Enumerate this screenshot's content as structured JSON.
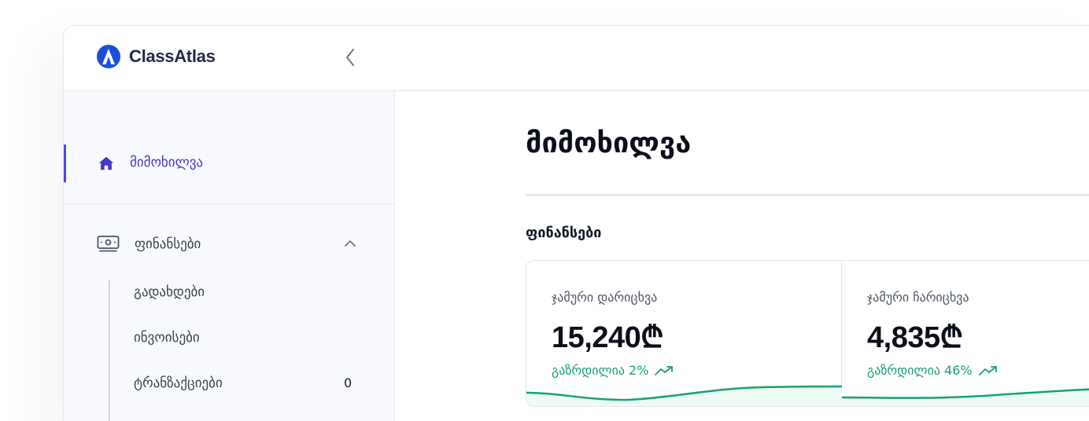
{
  "app": {
    "name": "ClassAtlas"
  },
  "sidebar": {
    "active_item": {
      "label": "მიმოხილვა",
      "icon": "home-icon"
    },
    "group": {
      "label": "ფინანსები",
      "icon": "money-icon",
      "expanded": true
    },
    "sub_items": [
      {
        "label": "გადახდები"
      },
      {
        "label": "ინვოისები"
      },
      {
        "label": "ტრანზაქციები",
        "count": "0"
      }
    ]
  },
  "main": {
    "title": "მიმოხილვა",
    "section": "ფინანსები",
    "cards": [
      {
        "label": "ჯამური დარიცხვა",
        "value": "15,240₾",
        "trend": "გაზრდილია 2%"
      },
      {
        "label": "ჯამური ჩარიცხვა",
        "value": "4,835₾",
        "trend": "გაზრდილია 46%"
      }
    ]
  },
  "colors": {
    "accent": "#4f46e5",
    "brand": "#1d4ed8",
    "positive": "#16a36a",
    "sidebar_bg": "#f7f9fc"
  }
}
